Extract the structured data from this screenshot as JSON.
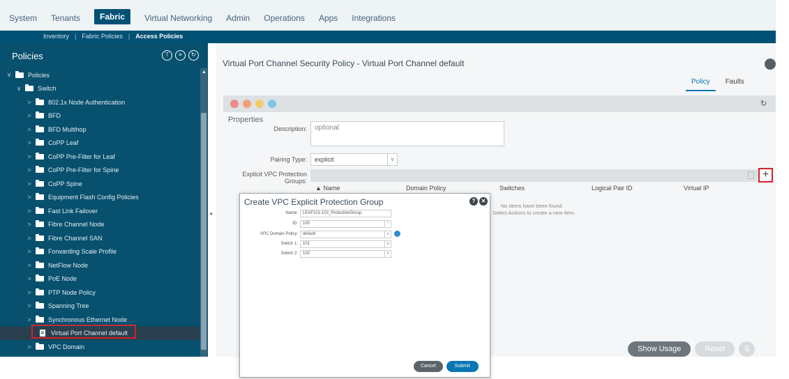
{
  "topnav": {
    "tabs": [
      {
        "label": "System"
      },
      {
        "label": "Tenants"
      },
      {
        "label": "Fabric",
        "active": true
      },
      {
        "label": "Virtual Networking"
      },
      {
        "label": "Admin"
      },
      {
        "label": "Operations"
      },
      {
        "label": "Apps"
      },
      {
        "label": "Integrations"
      }
    ]
  },
  "subnav": {
    "inventory": "Inventory",
    "fabric_policies": "Fabric Policies",
    "access_policies": "Access Policies",
    "separator": "|"
  },
  "left": {
    "title": "Policies",
    "icons": [
      "tag-icon",
      "list-icon",
      "refresh-icon"
    ],
    "tree": [
      {
        "label": "Policies",
        "chev": "∨",
        "type": "folder"
      },
      {
        "label": "Switch",
        "chev": "∨",
        "type": "folder"
      },
      {
        "label": "802.1x Node Authentication",
        "chev": ">",
        "type": "folder"
      },
      {
        "label": "BFD",
        "chev": ">",
        "type": "folder"
      },
      {
        "label": "BFD Multihop",
        "chev": ">",
        "type": "folder"
      },
      {
        "label": "CoPP Leaf",
        "chev": ">",
        "type": "folder"
      },
      {
        "label": "CoPP Pre-Filter for Leaf",
        "chev": ">",
        "type": "folder"
      },
      {
        "label": "CoPP Pre-Filter for Spine",
        "chev": ">",
        "type": "folder"
      },
      {
        "label": "CoPP Spine",
        "chev": ">",
        "type": "folder"
      },
      {
        "label": "Equipment Flash Config Policies",
        "chev": ">",
        "type": "folder"
      },
      {
        "label": "Fast Link Failover",
        "chev": ">",
        "type": "folder"
      },
      {
        "label": "Fibre Channel Node",
        "chev": ">",
        "type": "folder"
      },
      {
        "label": "Fibre Channel SAN",
        "chev": ">",
        "type": "folder"
      },
      {
        "label": "Forwarding Scale Profile",
        "chev": ">",
        "type": "folder"
      },
      {
        "label": "NetFlow Node",
        "chev": ">",
        "type": "folder"
      },
      {
        "label": "PoE Node",
        "chev": ">",
        "type": "folder"
      },
      {
        "label": "PTP Node Policy",
        "chev": ">",
        "type": "folder"
      },
      {
        "label": "Spanning Tree",
        "chev": ">",
        "type": "folder"
      },
      {
        "label": "Synchronous Ethernet Node",
        "chev": ">",
        "type": "folder"
      },
      {
        "label": "Virtual Port Channel default",
        "chev": "",
        "type": "doc",
        "selected": true
      },
      {
        "label": "VPC Domain",
        "chev": ">",
        "type": "folder"
      }
    ]
  },
  "right": {
    "title": "Virtual Port Channel Security Policy - Virtual Port Channel default",
    "tabs": {
      "policy": "Policy",
      "faults": "Faults"
    },
    "status_colors": [
      "#f08a8a",
      "#f3a07a",
      "#f6c96a",
      "#7fc6e6"
    ],
    "properties_label": "Properties",
    "description_label": "Description:",
    "description_placeholder": "optional",
    "pairing_type_label": "Pairing Type:",
    "pairing_type_value": "explicit",
    "explicit_groups_label": "Explicit VPC Protection Groups:",
    "columns": {
      "name": "▲ Name",
      "domain_policy": "Domain Policy",
      "switches": "Switches",
      "logical_pair_id": "Logical Pair ID",
      "virtual_ip": "Virtual IP"
    },
    "empty_line1": "No items have been found.",
    "empty_line2": "Select Actions to create a new item.",
    "buttons": {
      "show_usage": "Show Usage",
      "reset": "Reset",
      "submit_partial": "S"
    }
  },
  "dialog": {
    "title": "Create VPC Explicit Protection Group",
    "help_icon": "?",
    "close_icon": "✕",
    "fields": {
      "name_label": "Name:",
      "name_value": "LEAF101-102_ProtectionGroup",
      "id_label": "ID:",
      "id_value": "100",
      "domain_policy_label": "VPC Domain Policy:",
      "domain_policy_value": "default",
      "switch1_label": "Switch 1:",
      "switch1_value": "101",
      "switch2_label": "Switch 2:",
      "switch2_value": "102"
    },
    "cancel": "Cancel",
    "submit": "Submit"
  }
}
